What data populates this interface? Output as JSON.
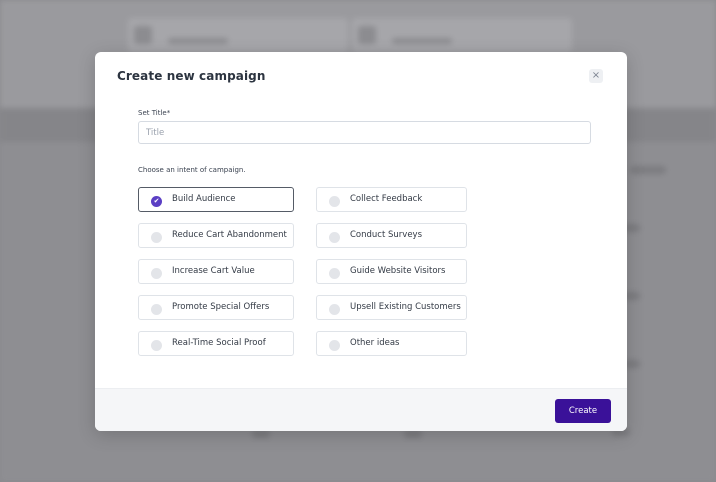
{
  "modal": {
    "title": "Create new campaign",
    "close_label": "×",
    "title_field": {
      "label": "Set Title*",
      "placeholder": "Title",
      "value": ""
    },
    "intent_label": "Choose an intent of campaign.",
    "selected_option": "Build Audience",
    "options": [
      {
        "label": "Build Audience",
        "selected": true
      },
      {
        "label": "Collect Feedback",
        "selected": false
      },
      {
        "label": "Reduce Cart Abandonment",
        "selected": false
      },
      {
        "label": "Conduct Surveys",
        "selected": false
      },
      {
        "label": "Increase Cart Value",
        "selected": false
      },
      {
        "label": "Guide Website Visitors",
        "selected": false
      },
      {
        "label": "Promote Special Offers",
        "selected": false
      },
      {
        "label": "Upsell Existing Customers",
        "selected": false
      },
      {
        "label": "Real-Time Social Proof",
        "selected": false
      },
      {
        "label": "Other ideas",
        "selected": false
      }
    ],
    "check_glyph": "✔",
    "create_label": "Create"
  },
  "colors": {
    "accent": "#3a1199",
    "radio_selected": "#5b3fc4",
    "overlay": "#8e8e92"
  }
}
